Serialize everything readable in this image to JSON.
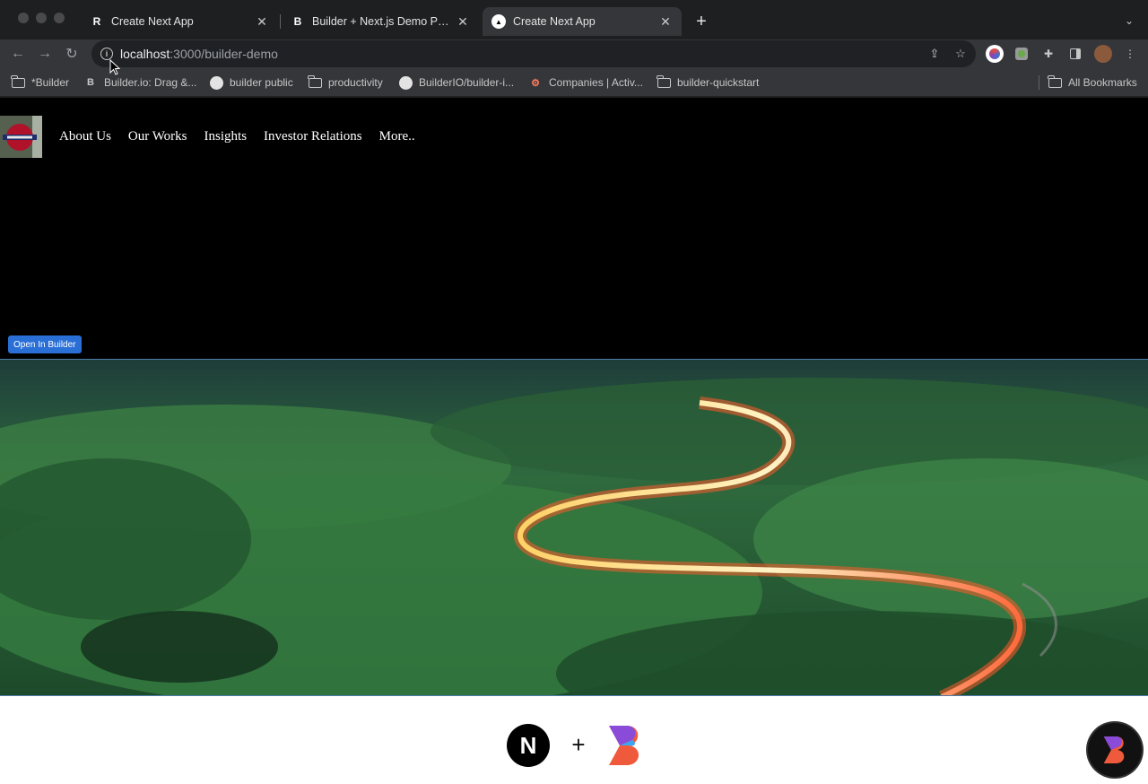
{
  "browser": {
    "tabs": [
      {
        "title": "Create Next App",
        "favicon": "R"
      },
      {
        "title": "Builder + Next.js Demo Page |",
        "favicon": "B"
      },
      {
        "title": "Create Next App",
        "favicon": "▲"
      }
    ],
    "close_glyph": "✕",
    "new_tab_glyph": "+",
    "url_host": "localhost",
    "url_path": ":3000/builder-demo",
    "bookmarks": [
      {
        "label": "*Builder",
        "icon": "folder-icon"
      },
      {
        "label": "Builder.io: Drag &...",
        "icon": "builder-icon"
      },
      {
        "label": "builder public",
        "icon": "github-icon"
      },
      {
        "label": "productivity",
        "icon": "folder-icon"
      },
      {
        "label": "BuilderIO/builder-i...",
        "icon": "github-icon"
      },
      {
        "label": "Companies | Activ...",
        "icon": "hubspot-icon"
      },
      {
        "label": "builder-quickstart",
        "icon": "folder-icon"
      }
    ],
    "all_bookmarks": "All Bookmarks"
  },
  "page": {
    "nav": [
      "About Us",
      "Our Works",
      "Insights",
      "Investor Relations",
      "More.."
    ],
    "open_in_builder": "Open In Builder",
    "plus": "+",
    "next_logo": "N"
  },
  "colors": {
    "accent": "#2a6fd6",
    "chrome_bg": "#35363a",
    "tabstrip_bg": "#1e1f20"
  }
}
